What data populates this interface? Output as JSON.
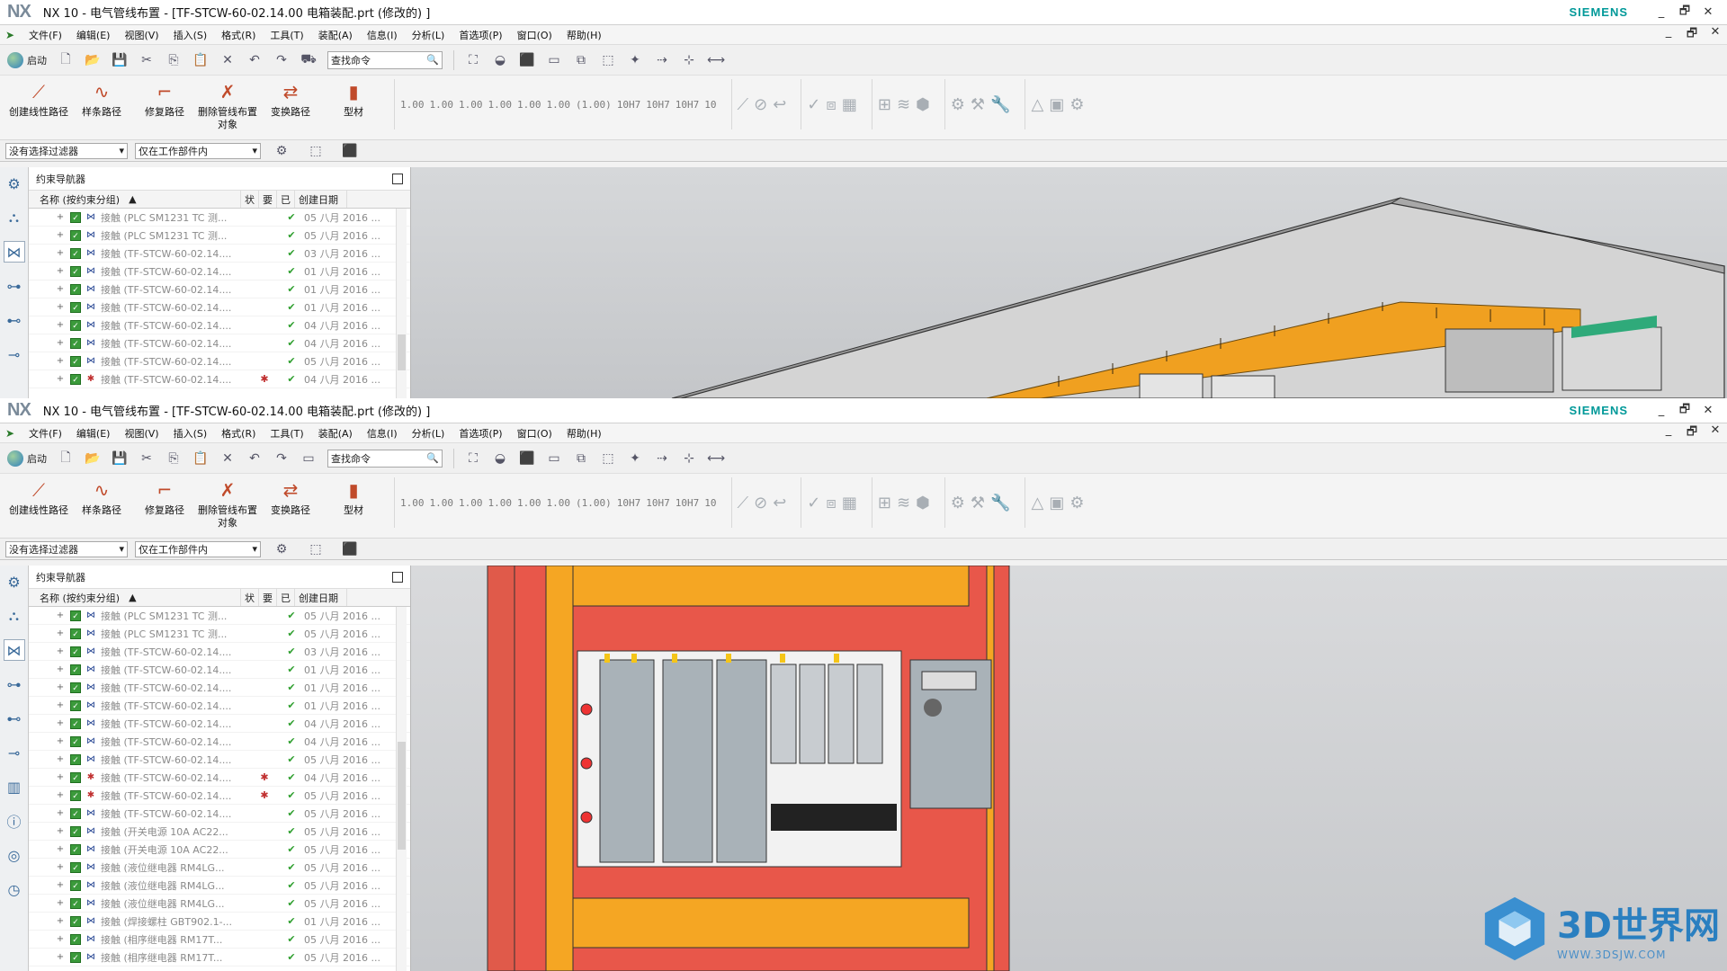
{
  "app": {
    "logo": "NX",
    "title": "NX 10 - 电气管线布置 - [TF-STCW-60-02.14.00 电箱装配.prt  (修改的) ]",
    "brand": "SIEMENS"
  },
  "window_controls": [
    "_",
    "🗗",
    "✕"
  ],
  "menu": {
    "items": [
      "文件(F)",
      "编辑(E)",
      "视图(V)",
      "插入(S)",
      "格式(R)",
      "工具(T)",
      "装配(A)",
      "信息(I)",
      "分析(L)",
      "首选项(P)",
      "窗口(O)",
      "帮助(H)"
    ]
  },
  "quick": {
    "start_label": "启动",
    "search_placeholder": "查找命令"
  },
  "ribbon": {
    "buttons": [
      {
        "label": "创建线性路径",
        "icon": "linear-path-icon"
      },
      {
        "label": "样条路径",
        "icon": "spline-path-icon"
      },
      {
        "label": "修复路径",
        "icon": "repair-path-icon"
      },
      {
        "label": "删除管线布置对象",
        "icon": "delete-routing-icon"
      },
      {
        "label": "变换路径",
        "icon": "transform-path-icon"
      },
      {
        "label": "型材",
        "icon": "stock-icon"
      }
    ],
    "tolerances": [
      "1.00",
      "1.00",
      "1.00",
      "1.00",
      "1.00",
      "1.00",
      "(1.00)",
      "10H7",
      "10H7",
      "10H7",
      "10"
    ]
  },
  "filter": {
    "selection_filter": "没有选择过滤器",
    "scope": "仅在工作部件内"
  },
  "navigator": {
    "title": "约束导航器",
    "columns": {
      "name": "名称 (按约束分组)",
      "status": "状",
      "required": "要",
      "applied": "已",
      "date": "创建日期"
    }
  },
  "rows_top": [
    {
      "name": "接触 (PLC SM1231 TC  测...",
      "date": "05 八月 2016 ...",
      "warn": false
    },
    {
      "name": "接触 (PLC SM1231 TC  测...",
      "date": "05 八月 2016 ...",
      "warn": false
    },
    {
      "name": "接触 (TF-STCW-60-02.14....",
      "date": "03 八月 2016 ...",
      "warn": false
    },
    {
      "name": "接触 (TF-STCW-60-02.14....",
      "date": "01 八月 2016 ...",
      "warn": false
    },
    {
      "name": "接触 (TF-STCW-60-02.14....",
      "date": "01 八月 2016 ...",
      "warn": false
    },
    {
      "name": "接触 (TF-STCW-60-02.14....",
      "date": "01 八月 2016 ...",
      "warn": false
    },
    {
      "name": "接触 (TF-STCW-60-02.14....",
      "date": "04 八月 2016 ...",
      "warn": false
    },
    {
      "name": "接触 (TF-STCW-60-02.14....",
      "date": "04 八月 2016 ...",
      "warn": false
    },
    {
      "name": "接触 (TF-STCW-60-02.14....",
      "date": "05 八月 2016 ...",
      "warn": false
    },
    {
      "name": "接触 (TF-STCW-60-02.14....",
      "date": "04 八月 2016 ...",
      "warn": true
    }
  ],
  "rows_bottom": [
    {
      "name": "接触 (PLC SM1231 TC  测...",
      "date": "05 八月 2016 ...",
      "warn": false
    },
    {
      "name": "接触 (PLC SM1231 TC  测...",
      "date": "05 八月 2016 ...",
      "warn": false
    },
    {
      "name": "接触 (TF-STCW-60-02.14....",
      "date": "03 八月 2016 ...",
      "warn": false
    },
    {
      "name": "接触 (TF-STCW-60-02.14....",
      "date": "01 八月 2016 ...",
      "warn": false
    },
    {
      "name": "接触 (TF-STCW-60-02.14....",
      "date": "01 八月 2016 ...",
      "warn": false
    },
    {
      "name": "接触 (TF-STCW-60-02.14....",
      "date": "01 八月 2016 ...",
      "warn": false
    },
    {
      "name": "接触 (TF-STCW-60-02.14....",
      "date": "04 八月 2016 ...",
      "warn": false
    },
    {
      "name": "接触 (TF-STCW-60-02.14....",
      "date": "04 八月 2016 ...",
      "warn": false
    },
    {
      "name": "接触 (TF-STCW-60-02.14....",
      "date": "05 八月 2016 ...",
      "warn": false
    },
    {
      "name": "接触 (TF-STCW-60-02.14....",
      "date": "04 八月 2016 ...",
      "warn": true
    },
    {
      "name": "接触 (TF-STCW-60-02.14....",
      "date": "05 八月 2016 ...",
      "warn": true
    },
    {
      "name": "接触 (TF-STCW-60-02.14....",
      "date": "05 八月 2016 ...",
      "warn": false
    },
    {
      "name": "接触 (开关电源 10A AC22...",
      "date": "05 八月 2016 ...",
      "warn": false
    },
    {
      "name": "接触 (开关电源 10A AC22...",
      "date": "05 八月 2016 ...",
      "warn": false
    },
    {
      "name": "接触 (液位继电器 RM4LG...",
      "date": "05 八月 2016 ...",
      "warn": false
    },
    {
      "name": "接触 (液位继电器 RM4LG...",
      "date": "05 八月 2016 ...",
      "warn": false
    },
    {
      "name": "接触 (液位继电器 RM4LG...",
      "date": "05 八月 2016 ...",
      "warn": false
    },
    {
      "name": "接触 (焊接螺柱 GBT902.1-...",
      "date": "01 八月 2016 ...",
      "warn": false
    },
    {
      "name": "接触 (相序继电器 RM17T...",
      "date": "05 八月 2016 ...",
      "warn": false
    },
    {
      "name": "接触 (相序继电器 RM17T...",
      "date": "05 八月 2016 ...",
      "warn": false
    }
  ],
  "watermark": {
    "big": "3D世界网",
    "small": "WWW.3DSJW.COM"
  },
  "colors": {
    "accent": "#009999",
    "panel_red": "#e8574a",
    "duct_orange": "#f5a623",
    "check_green": "#3b9a3b"
  }
}
